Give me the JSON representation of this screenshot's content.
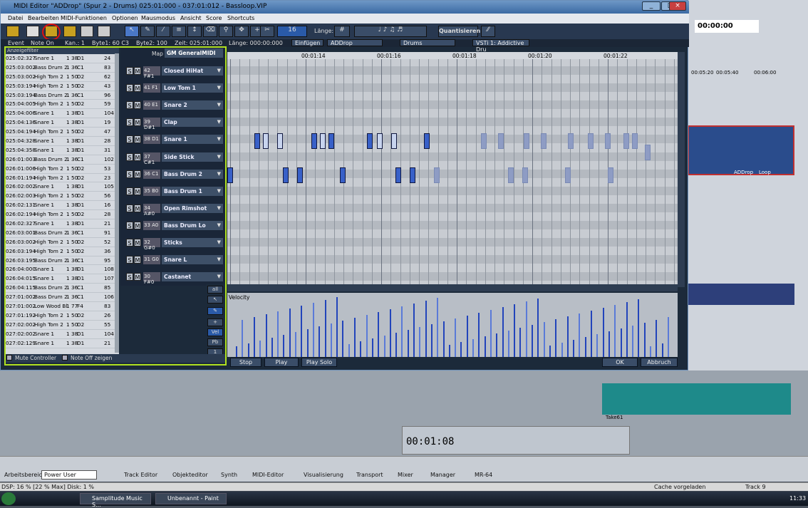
{
  "window": {
    "title": "MIDI Editor \"ADDrop\" (Spur 2 - Drums) 025:01:000 - 037:01:012 - Bassloop.VIP"
  },
  "menu": [
    "Datei",
    "Bearbeiten",
    "MIDI-Funktionen",
    "Optionen",
    "Mausmodus",
    "Ansicht",
    "Score",
    "Shortcuts"
  ],
  "toolbar": {
    "laenge_label": "Länge:",
    "quant_label": "Quantisieren",
    "grid_value": "16"
  },
  "infobar": {
    "event": "Event",
    "note": "Note On",
    "kan": "Kan.: 1",
    "byte1": "Byte1: 60 C3",
    "byte2": "Byte2: 100",
    "zeit": "Zeit: 025:01:000",
    "laenge": "Länge: 000:00:000",
    "einfuegen": "Einfügen",
    "track": "ADDrop",
    "drums": "Drums",
    "vsti": "VSTi 1: Addictive Dru"
  },
  "eventlist": {
    "header": "Anzeigefilter",
    "rows": [
      [
        "025:02:327",
        "Snare 1",
        "1",
        "38",
        "D1",
        "24"
      ],
      [
        "025:03:002",
        "Bass Drum 2",
        "1",
        "36",
        "C1",
        "83"
      ],
      [
        "025:03:002",
        "High Tom 2",
        "1",
        "50",
        "D2",
        "62"
      ],
      [
        "025:03:194",
        "High Tom 2",
        "1",
        "50",
        "D2",
        "43"
      ],
      [
        "025:03:194",
        "Bass Drum 2",
        "1",
        "36",
        "C1",
        "96"
      ],
      [
        "025:04:005",
        "High Tom 2",
        "1",
        "50",
        "D2",
        "59"
      ],
      [
        "025:04:006",
        "Snare 1",
        "1",
        "38",
        "D1",
        "104"
      ],
      [
        "025:04:136",
        "Snare 1",
        "1",
        "38",
        "D1",
        "19"
      ],
      [
        "025:04:194",
        "High Tom 2",
        "1",
        "50",
        "D2",
        "47"
      ],
      [
        "025:04:328",
        "Snare 1",
        "1",
        "38",
        "D1",
        "28"
      ],
      [
        "025:04:358",
        "Snare 1",
        "1",
        "38",
        "D1",
        "31"
      ],
      [
        "026:01:003",
        "Bass Drum 2",
        "1",
        "36",
        "C1",
        "102"
      ],
      [
        "026:01:006",
        "High Tom 2",
        "1",
        "50",
        "D2",
        "53"
      ],
      [
        "026:01:194",
        "High Tom 2",
        "1",
        "50",
        "D2",
        "23"
      ],
      [
        "026:02:002",
        "Snare 1",
        "1",
        "38",
        "D1",
        "105"
      ],
      [
        "026:02:003",
        "High Tom 2",
        "1",
        "50",
        "D2",
        "56"
      ],
      [
        "026:02:131",
        "Snare 1",
        "1",
        "38",
        "D1",
        "16"
      ],
      [
        "026:02:194",
        "High Tom 2",
        "1",
        "50",
        "D2",
        "28"
      ],
      [
        "026:02:327",
        "Snare 1",
        "1",
        "38",
        "D1",
        "21"
      ],
      [
        "026:03:001",
        "Bass Drum 2",
        "1",
        "36",
        "C1",
        "91"
      ],
      [
        "026:03:002",
        "High Tom 2",
        "1",
        "50",
        "D2",
        "52"
      ],
      [
        "026:03:194",
        "High Tom 2",
        "1",
        "50",
        "D2",
        "36"
      ],
      [
        "026:03:195",
        "Bass Drum 2",
        "1",
        "36",
        "C1",
        "95"
      ],
      [
        "026:04:000",
        "Snare 1",
        "1",
        "38",
        "D1",
        "108"
      ],
      [
        "026:04:015",
        "Snare 1",
        "1",
        "38",
        "D1",
        "107"
      ],
      [
        "026:04:115",
        "Bass Drum 2",
        "1",
        "36",
        "C1",
        "85"
      ],
      [
        "027:01:002",
        "Bass Drum 2",
        "1",
        "36",
        "C1",
        "106"
      ],
      [
        "027:01:002",
        "Low Wood Bl",
        "1",
        "77",
        "F4",
        "83"
      ],
      [
        "027:01:192",
        "High Tom 2",
        "1",
        "50",
        "D2",
        "26"
      ],
      [
        "027:02:002",
        "High Tom 2",
        "1",
        "50",
        "D2",
        "55"
      ],
      [
        "027:02:002",
        "Snare 1",
        "1",
        "38",
        "D1",
        "104"
      ],
      [
        "027:02:129",
        "Snare 1",
        "1",
        "38",
        "D1",
        "21"
      ]
    ]
  },
  "mute": {
    "controller": "Mute Controller",
    "noteoff": "Note Off zeigen"
  },
  "drummap": {
    "map_label": "Map",
    "map_value": "GM GeneralMIDI",
    "items": [
      [
        "42 F#1",
        "Closed HiHat"
      ],
      [
        "41 F1",
        "Low Tom 1"
      ],
      [
        "40 E1",
        "Snare 2"
      ],
      [
        "39 D#1",
        "Clap"
      ],
      [
        "38 D1",
        "Snare 1"
      ],
      [
        "37 C#1",
        "Side Stick"
      ],
      [
        "36 C1",
        "Bass Drum 2"
      ],
      [
        "35 B0",
        "Bass Drum 1"
      ],
      [
        "34 A#0",
        "Open Rimshot"
      ],
      [
        "33 A0",
        "Bass Drum Lo"
      ],
      [
        "32 G#0",
        "Sticks"
      ],
      [
        "31 G0",
        "Snare L"
      ],
      [
        "30 F#0",
        "Castanet"
      ]
    ]
  },
  "ruler": [
    "00:01:14",
    "00:01:16",
    "00:01:18",
    "00:01:20",
    "00:01:22"
  ],
  "velocity_label": "Velocity",
  "buttons": {
    "stop": "Stop",
    "play": "Play",
    "playsolo": "Play Solo",
    "ok": "OK",
    "abbruch": "Abbruch"
  },
  "transport": {
    "time": "00:01:08",
    "top": "00:00:00"
  },
  "bottombar": [
    "Track Editor",
    "Objekteditor",
    "Synth",
    "MIDI-Editor",
    "Visualisierung",
    "Transport",
    "Mixer",
    "Manager",
    "MR-64"
  ],
  "workspace": {
    "label": "Arbeitsbereich:",
    "value": "Power User"
  },
  "status": {
    "left": "DSP: 16 % [22 % Max]  Disk: 1 %",
    "cache": "Cache vorgeladen",
    "track": "Track 9"
  },
  "taskbar": {
    "app1": "Samplitude Music S...",
    "app2": "Unbenannt - Paint",
    "clock": "11:33"
  },
  "bg_labels": {
    "t1": "00:05:20",
    "t2": "00:05:40",
    "t3": "00:06:00",
    "take": "Take61",
    "loop": "Loop",
    "addrop": "ADDrop"
  }
}
